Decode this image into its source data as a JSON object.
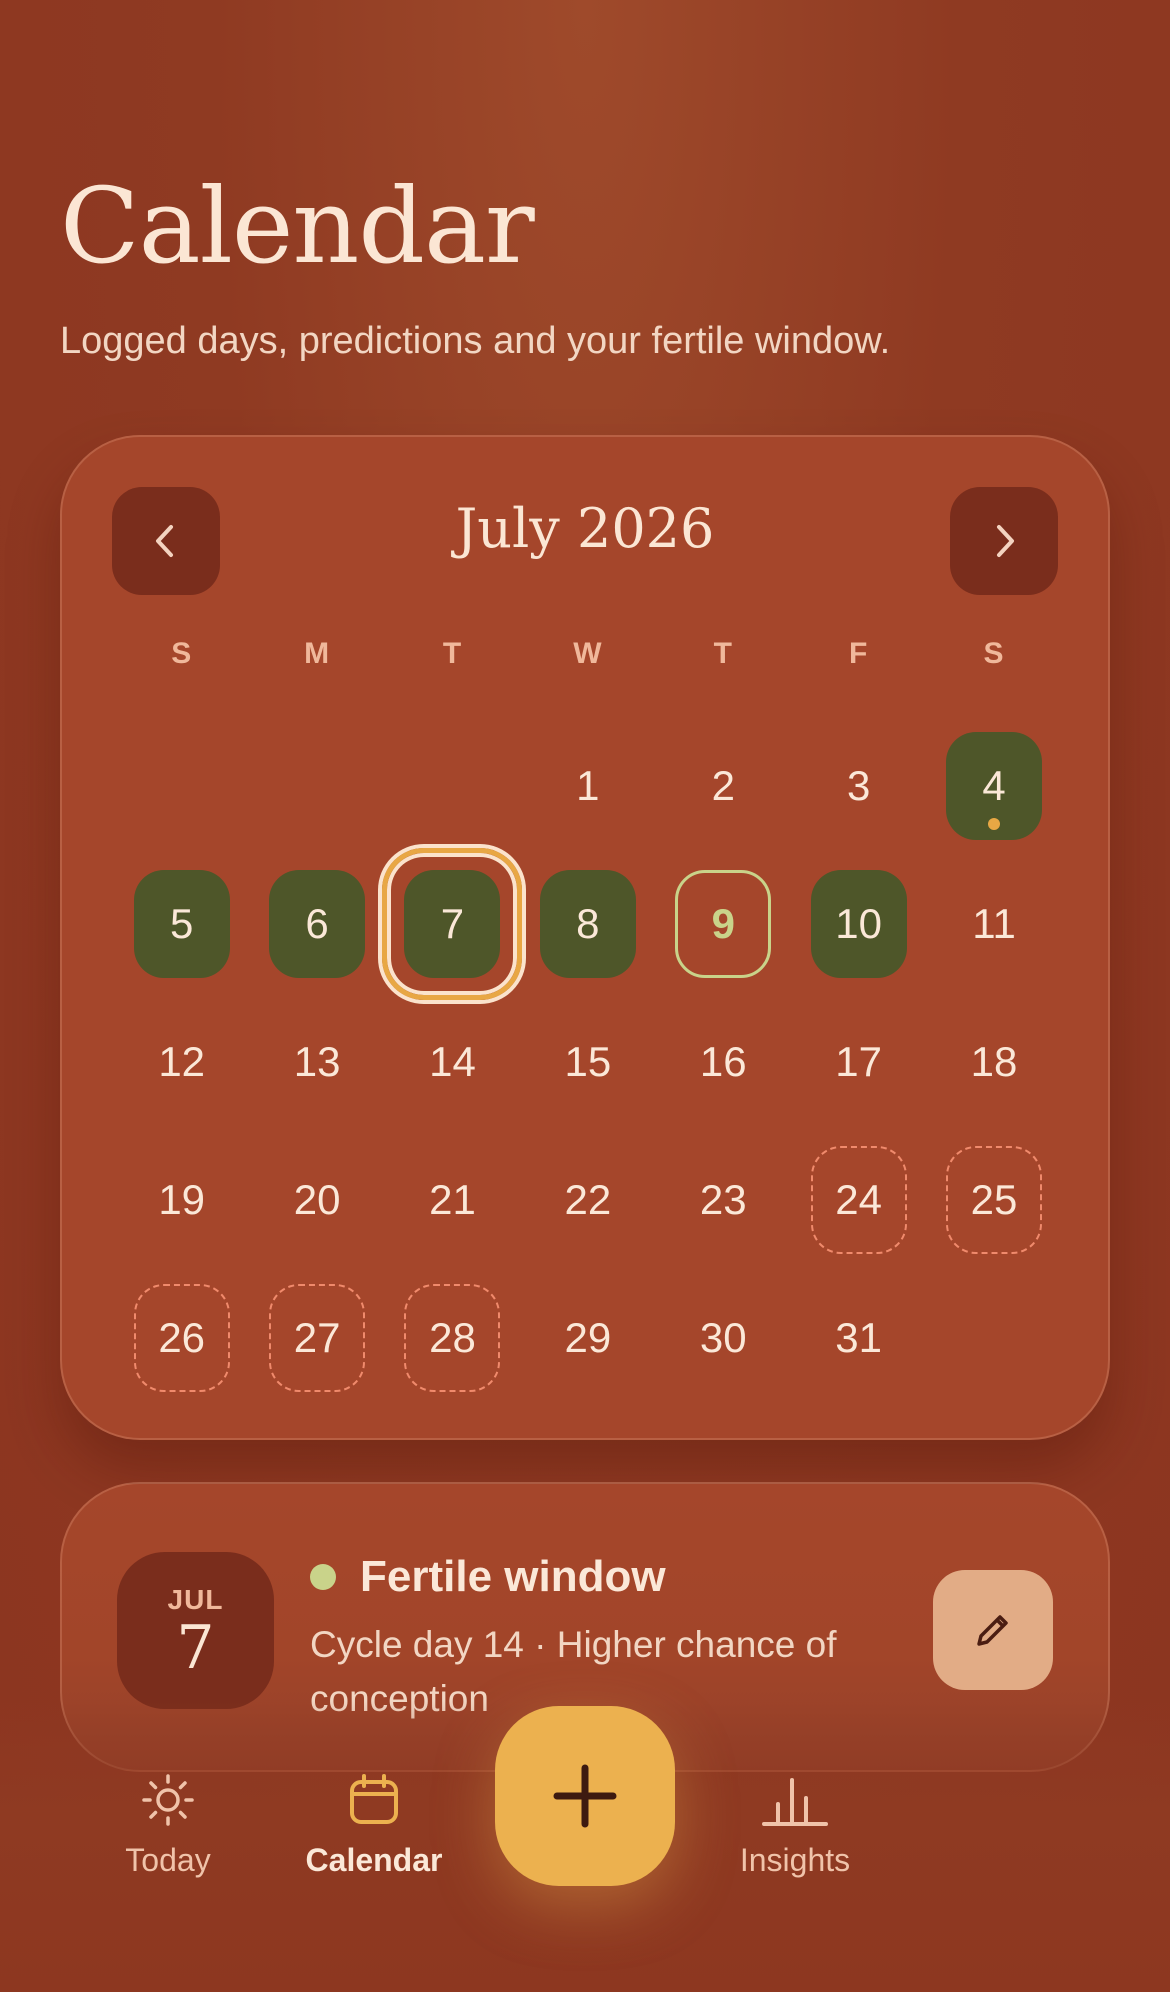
{
  "header": {
    "title": "Calendar",
    "subtitle": "Logged days, predictions and your fertile window."
  },
  "calendar": {
    "month_label": "July 2026",
    "prev_icon": "chevron-left-icon",
    "next_icon": "chevron-right-icon",
    "weekdays": [
      "S",
      "M",
      "T",
      "W",
      "T",
      "F",
      "S"
    ],
    "leading_blank_days": 3,
    "days": [
      {
        "day": "1",
        "state": "none"
      },
      {
        "day": "2",
        "state": "none"
      },
      {
        "day": "3",
        "state": "none"
      },
      {
        "day": "4",
        "state": "logged",
        "has_dot": true
      },
      {
        "day": "5",
        "state": "logged"
      },
      {
        "day": "6",
        "state": "logged"
      },
      {
        "day": "7",
        "state": "logged",
        "today": true
      },
      {
        "day": "8",
        "state": "logged"
      },
      {
        "day": "9",
        "state": "predicted"
      },
      {
        "day": "10",
        "state": "logged"
      },
      {
        "day": "11",
        "state": "none"
      },
      {
        "day": "12",
        "state": "none"
      },
      {
        "day": "13",
        "state": "none"
      },
      {
        "day": "14",
        "state": "none"
      },
      {
        "day": "15",
        "state": "none"
      },
      {
        "day": "16",
        "state": "none"
      },
      {
        "day": "17",
        "state": "none"
      },
      {
        "day": "18",
        "state": "none"
      },
      {
        "day": "19",
        "state": "none"
      },
      {
        "day": "20",
        "state": "none"
      },
      {
        "day": "21",
        "state": "none"
      },
      {
        "day": "22",
        "state": "none"
      },
      {
        "day": "23",
        "state": "none"
      },
      {
        "day": "24",
        "state": "period-predicted"
      },
      {
        "day": "25",
        "state": "period-predicted"
      },
      {
        "day": "26",
        "state": "period-predicted"
      },
      {
        "day": "27",
        "state": "period-predicted"
      },
      {
        "day": "28",
        "state": "period-predicted"
      },
      {
        "day": "29",
        "state": "none"
      },
      {
        "day": "30",
        "state": "none"
      },
      {
        "day": "31",
        "state": "none"
      }
    ]
  },
  "selected_day": {
    "month": "JUL",
    "day": "7",
    "phase_title": "Fertile window",
    "description": "Cycle day 14 · Higher chance of conception",
    "edit_icon": "pencil-icon"
  },
  "tab_bar": {
    "tabs": [
      {
        "label": "Today",
        "icon": "sun-icon",
        "active": false
      },
      {
        "label": "Calendar",
        "icon": "calendar-icon",
        "active": true
      },
      {
        "label": "Insights",
        "icon": "bar-chart-icon",
        "active": false
      }
    ],
    "fab_icon": "plus-icon"
  },
  "colors": {
    "background": "#8f3a22",
    "card": "#a5462b",
    "logged": "#4e5629",
    "fertile": "#c9d38a",
    "accent": "#ecb14f",
    "period_predicted": "#f08a6c"
  }
}
